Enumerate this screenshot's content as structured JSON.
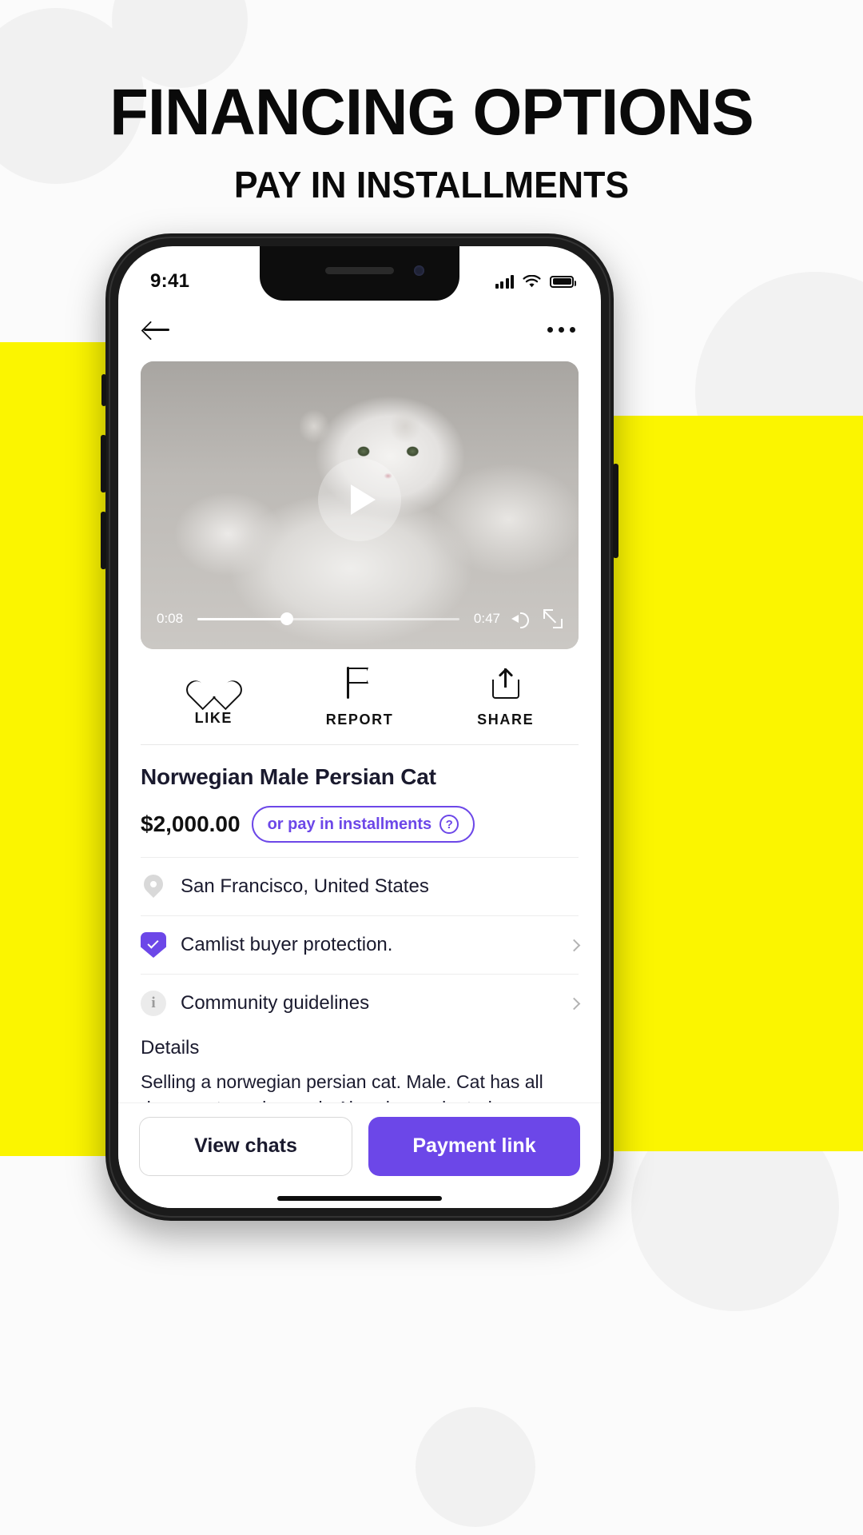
{
  "header": {
    "title": "FINANCING OPTIONS",
    "subtitle": "PAY IN INSTALLMENTS"
  },
  "statusbar": {
    "time": "9:41",
    "signal_icon": "cellular-signal-icon",
    "wifi_icon": "wifi-icon",
    "battery_icon": "battery-icon"
  },
  "appnav": {
    "back_icon": "back-arrow-icon",
    "more_icon": "more-options-icon"
  },
  "video": {
    "current_time": "0:08",
    "duration": "0:47",
    "play_icon": "play-icon",
    "volume_icon": "volume-icon",
    "expand_icon": "expand-icon",
    "progress_percent": 34
  },
  "actions": [
    {
      "label": "LIKE",
      "icon": "heart-icon"
    },
    {
      "label": "REPORT",
      "icon": "flag-icon"
    },
    {
      "label": "SHARE",
      "icon": "share-icon"
    }
  ],
  "listing": {
    "title": "Norwegian Male Persian Cat",
    "price": "$2,000.00",
    "installments_label": "or pay in installments",
    "installments_help": "?",
    "accent_color": "#6c47e8",
    "rows": [
      {
        "icon": "location-pin-icon",
        "text": "San Francisco, United States",
        "chevron": false
      },
      {
        "icon": "shield-check-icon",
        "text": "Camlist buyer protection.",
        "chevron": true
      },
      {
        "icon": "info-circle-icon",
        "text": "Community guidelines",
        "chevron": true
      }
    ],
    "details_heading": "Details",
    "details_text": "Selling a norwegian persian cat. Male. Cat has all documents and a mark. Already vaccinated"
  },
  "bottombar": {
    "secondary_label": "View chats",
    "primary_label": "Payment link"
  },
  "theme": {
    "yellow": "#fbf500",
    "purple": "#6c47e8",
    "background": "#fbfbfb"
  }
}
